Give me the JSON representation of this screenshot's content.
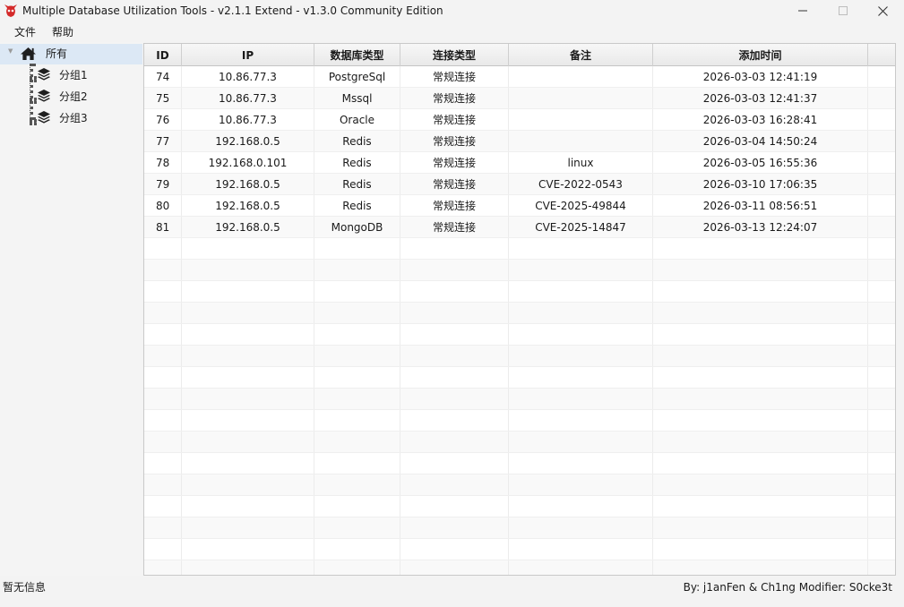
{
  "window": {
    "title": "Multiple Database Utilization Tools - v2.1.1 Extend - v1.3.0 Community Edition",
    "logo_icon": "red-devil-logo-icon",
    "controls": [
      "minimize-icon",
      "maximize-icon",
      "close-icon"
    ]
  },
  "menu": {
    "file": "文件",
    "help": "帮助"
  },
  "tree": {
    "root": {
      "label": "所有",
      "icon": "home-icon"
    },
    "groups": [
      {
        "label": "分组1",
        "icon": "layers-icon"
      },
      {
        "label": "分组2",
        "icon": "layers-icon"
      },
      {
        "label": "分组3",
        "icon": "layers-icon"
      }
    ]
  },
  "table": {
    "columns": [
      "ID",
      "IP",
      "数据库类型",
      "连接类型",
      "备注",
      "添加时间"
    ],
    "rows": [
      {
        "id": "74",
        "ip": "10.86.77.3",
        "db_type": "PostgreSql",
        "conn_type": "常规连接",
        "note": "",
        "added": "2026-03-03 12:41:19"
      },
      {
        "id": "75",
        "ip": "10.86.77.3",
        "db_type": "Mssql",
        "conn_type": "常规连接",
        "note": "",
        "added": "2026-03-03 12:41:37"
      },
      {
        "id": "76",
        "ip": "10.86.77.3",
        "db_type": "Oracle",
        "conn_type": "常规连接",
        "note": "",
        "added": "2026-03-03 16:28:41"
      },
      {
        "id": "77",
        "ip": "192.168.0.5",
        "db_type": "Redis",
        "conn_type": "常规连接",
        "note": "",
        "added": "2026-03-04 14:50:24"
      },
      {
        "id": "78",
        "ip": "192.168.0.101",
        "db_type": "Redis",
        "conn_type": "常规连接",
        "note": "linux",
        "added": "2026-03-05 16:55:36"
      },
      {
        "id": "79",
        "ip": "192.168.0.5",
        "db_type": "Redis",
        "conn_type": "常规连接",
        "note": "CVE-2022-0543",
        "added": "2026-03-10 17:06:35"
      },
      {
        "id": "80",
        "ip": "192.168.0.5",
        "db_type": "Redis",
        "conn_type": "常规连接",
        "note": "CVE-2025-49844",
        "added": "2026-03-11 08:56:51"
      },
      {
        "id": "81",
        "ip": "192.168.0.5",
        "db_type": "MongoDB",
        "conn_type": "常规连接",
        "note": "CVE-2025-14847",
        "added": "2026-03-13 12:24:07"
      }
    ]
  },
  "status": {
    "left": "暂无信息",
    "right": "By: j1anFen & Ch1ng Modifier: S0cke3t"
  },
  "colors": {
    "selected_tree_row": "#dce8f5",
    "logo_red": "#d42a2a"
  }
}
